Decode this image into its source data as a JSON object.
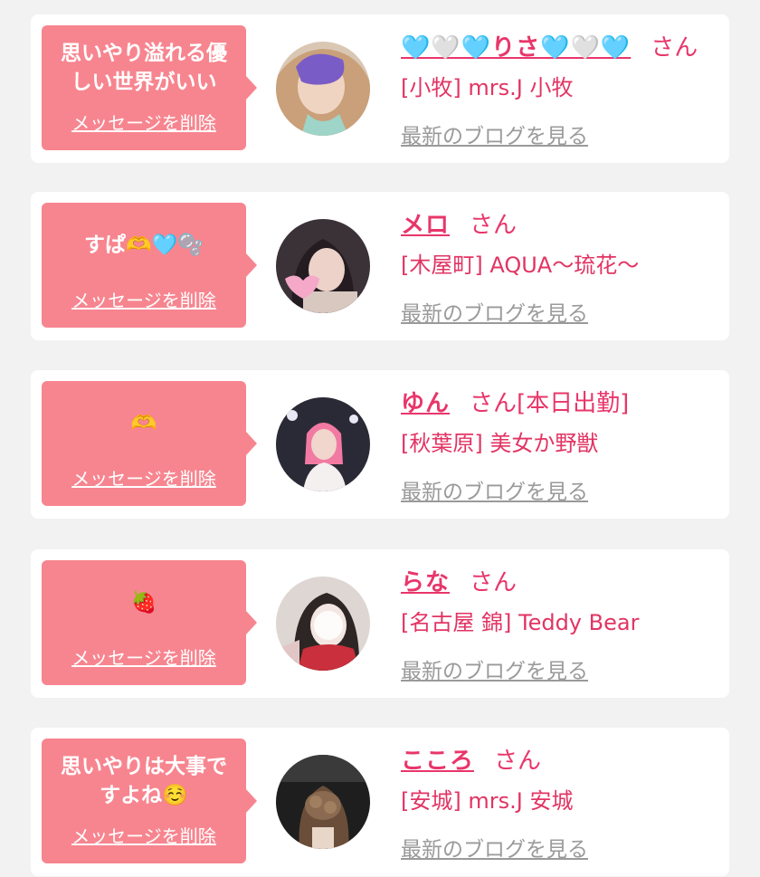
{
  "common": {
    "delete_label": "メッセージを削除",
    "san": "さん",
    "blog_link": "最新のブログを見る"
  },
  "colors": {
    "accent": "#e8366a",
    "bubble": "#f7858f",
    "background": "#f2f2f2"
  },
  "messages": [
    {
      "message": "思いやり溢れる優\nしい世界がいい",
      "name": "🩵🤍🩵りさ🩵🤍🩵",
      "suffix": "",
      "shop": "[小牧] mrs.J 小牧"
    },
    {
      "message": "すぱ🫶🩵🫧",
      "name": "メロ",
      "suffix": "",
      "shop": "[木屋町] AQUA〜琉花〜"
    },
    {
      "message": "🫶",
      "name": "ゆん",
      "suffix": "[本日出勤]",
      "shop": "[秋葉原] 美女か野獣"
    },
    {
      "message": "🍓",
      "name": "らな",
      "suffix": "",
      "shop": "[名古屋 錦] Teddy Bear"
    },
    {
      "message": "思いやりは大事で\nすよね☺️",
      "name": "こころ",
      "suffix": "",
      "shop": "[安城] mrs.J 安城"
    }
  ]
}
